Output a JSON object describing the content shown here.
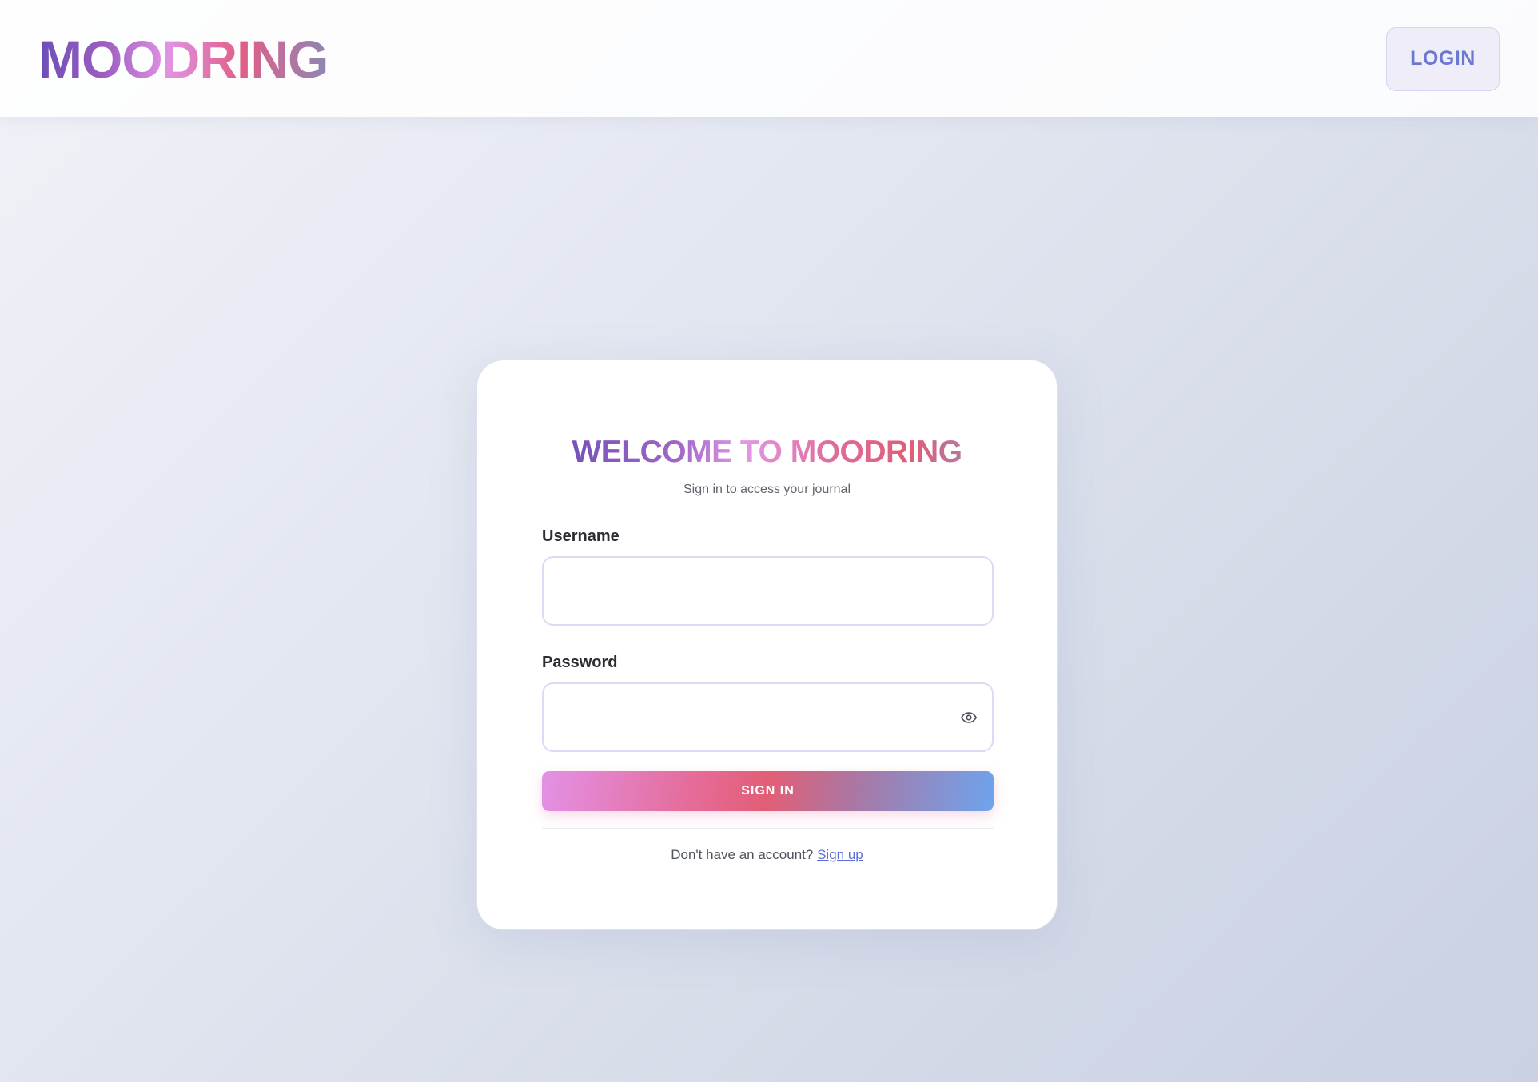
{
  "header": {
    "logo": "MOODRING",
    "login_label": "LOGIN"
  },
  "login_card": {
    "title": "WELCOME TO MOODRING",
    "subtitle": "Sign in to access your journal",
    "username": {
      "label": "Username",
      "value": "",
      "placeholder": ""
    },
    "password": {
      "label": "Password",
      "value": "",
      "placeholder": "",
      "toggle_icon": "eye-icon"
    },
    "signin_label": "SIGN IN",
    "signup_prompt": "Don't have an account?",
    "signup_link": "Sign up"
  },
  "colors": {
    "accent_blue": "#5a6ed8",
    "gradient_pink": "#e391e6",
    "gradient_red": "#e25e76",
    "gradient_blue": "#6ea3ee",
    "logo_purple": "#6c4fb7"
  }
}
